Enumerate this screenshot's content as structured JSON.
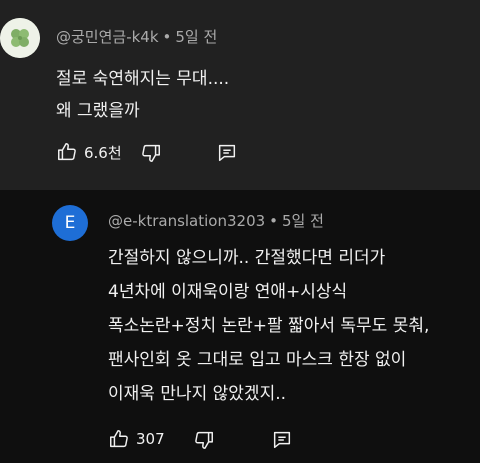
{
  "top_comment": {
    "author": "@궁민연금-k4k",
    "separator": "•",
    "time": "5일 전",
    "lines": [
      "절로 숙연해지는 무대....",
      "왜 그랬을까"
    ],
    "like_count": "6.6천"
  },
  "reply": {
    "avatar_letter": "E",
    "author": "@e-ktranslation3203",
    "separator": "•",
    "time": "5일 전",
    "lines": [
      "간절하지 않으니까.. 간절했다면 리더가",
      "4년차에 이재욱이랑 연애+시상식",
      "폭소논란+정치 논란+팔 짧아서 독무도 못춰,",
      "팬사인회 옷 그대로 입고 마스크 한장 없이",
      "이재욱 만나지 않았겠지.."
    ],
    "like_count": "307"
  },
  "colors": {
    "top_bg": "#212121",
    "reply_bg": "#0f0f0f",
    "meta_text": "#aaaaaa",
    "reply_avatar": "#1e6ed6"
  },
  "icons": [
    "clover-avatar-icon",
    "thumbs-up-icon",
    "thumbs-down-icon",
    "reply-icon"
  ]
}
